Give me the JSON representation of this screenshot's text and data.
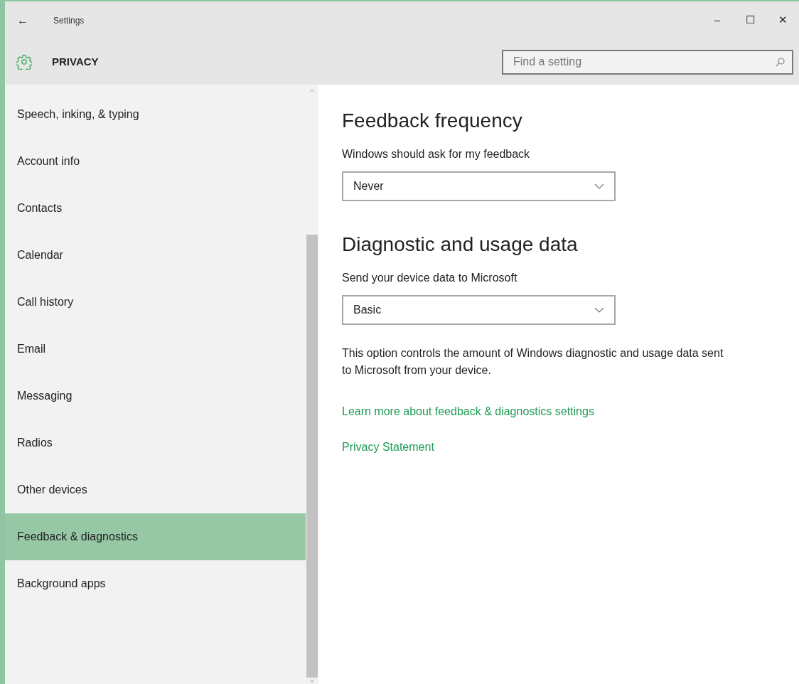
{
  "window": {
    "title": "Settings",
    "back": "←",
    "controls": [
      "–",
      "☐",
      "✕"
    ]
  },
  "header": {
    "title": "PRIVACY",
    "search": {
      "placeholder": "Find a setting"
    }
  },
  "sidebar": {
    "items": [
      {
        "label": "Speech, inking, & typing",
        "selected": false
      },
      {
        "label": "Account info",
        "selected": false
      },
      {
        "label": "Contacts",
        "selected": false
      },
      {
        "label": "Calendar",
        "selected": false
      },
      {
        "label": "Call history",
        "selected": false
      },
      {
        "label": "Email",
        "selected": false
      },
      {
        "label": "Messaging",
        "selected": false
      },
      {
        "label": "Radios",
        "selected": false
      },
      {
        "label": "Other devices",
        "selected": false
      },
      {
        "label": "Feedback & diagnostics",
        "selected": true
      },
      {
        "label": "Background apps",
        "selected": false
      }
    ]
  },
  "content": {
    "sections": [
      {
        "heading": "Feedback frequency",
        "label": "Windows should ask for my feedback",
        "value": "Never"
      },
      {
        "heading": "Diagnostic and usage data",
        "label": "Send your device data to Microsoft",
        "value": "Basic",
        "description": "This option controls the amount of Windows diagnostic and usage data sent to Microsoft from your device."
      }
    ],
    "links": [
      "Learn more about feedback & diagnostics settings",
      "Privacy Statement"
    ]
  }
}
